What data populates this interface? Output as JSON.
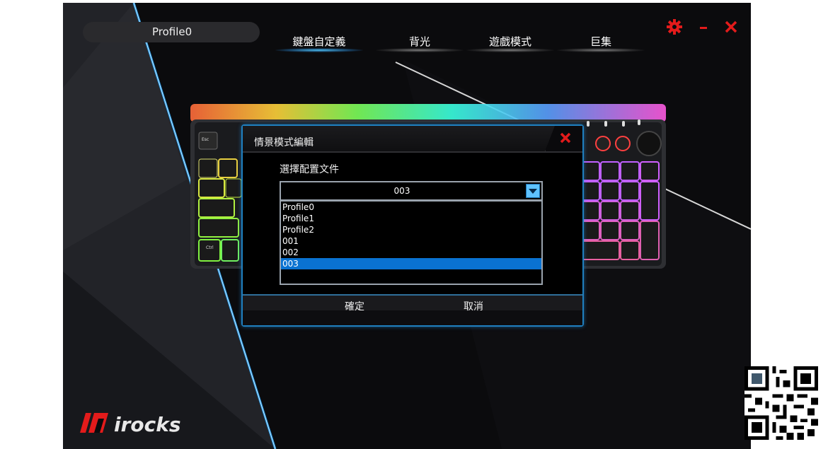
{
  "header": {
    "profile_name": "Profile0"
  },
  "tabs": [
    {
      "label": "鍵盤自定義",
      "active": true
    },
    {
      "label": "背光",
      "active": false
    },
    {
      "label": "遊戲模式",
      "active": false
    },
    {
      "label": "巨集",
      "active": false
    }
  ],
  "window_controls": {
    "settings_icon": "gear-icon",
    "minimize_icon": "minimize-icon",
    "close_icon": "close-icon",
    "color": "#e31b1b"
  },
  "keyboard_labels": {
    "esc": "Esc",
    "ctrl": "Ctrl"
  },
  "dialog": {
    "title": "情景模式編輯",
    "label": "選擇配置文件",
    "selected_value": "003",
    "options": [
      "Profile0",
      "Profile1",
      "Profile2",
      "001",
      "002",
      "003"
    ],
    "selected_index": 5,
    "confirm_label": "確定",
    "cancel_label": "取消"
  },
  "brand": {
    "logo_text": "irocks",
    "accent": "#e31b1b"
  },
  "colors": {
    "accent_blue": "#0a72d1",
    "dialog_border": "#1f7fbf"
  }
}
